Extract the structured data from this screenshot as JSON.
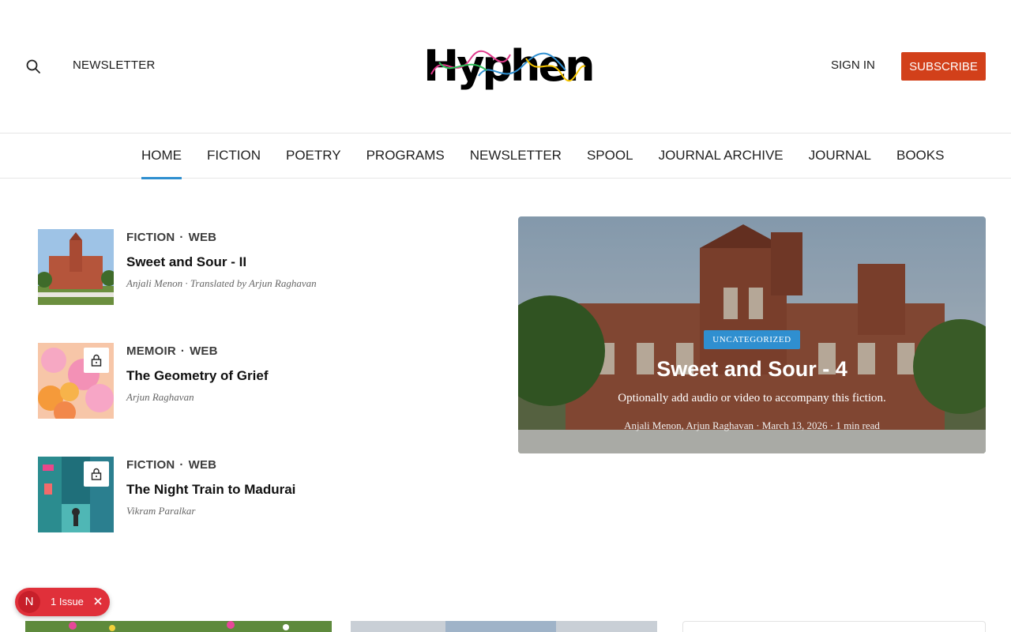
{
  "header": {
    "newsletter_label": "NEWSLETTER",
    "logo_text": "Hyphen",
    "signin_label": "SIGN IN",
    "subscribe_label": "SUBSCRIBE"
  },
  "nav": {
    "items": [
      "HOME",
      "FICTION",
      "POETRY",
      "PROGRAMS",
      "NEWSLETTER",
      "SPOOL",
      "JOURNAL ARCHIVE",
      "JOURNAL",
      "BOOKS"
    ],
    "active": "HOME"
  },
  "stories": [
    {
      "category": "FICTION",
      "format": "WEB",
      "title": "Sweet and Sour - II",
      "byline": "Anjali Menon · Translated by Arjun Raghavan",
      "locked": false
    },
    {
      "category": "MEMOIR",
      "format": "WEB",
      "title": "The Geometry of Grief",
      "byline": "Arjun Raghavan",
      "locked": true
    },
    {
      "category": "FICTION",
      "format": "WEB",
      "title": "The Night Train to Madurai",
      "byline": "Vikram Paralkar",
      "locked": true
    }
  ],
  "feature": {
    "badge": "UNCATEGORIZED",
    "title": "Sweet and Sour - 4",
    "description": "Optionally add audio or video to accompany this fiction.",
    "byline": "Anjali Menon, Arjun Raghavan · March 13, 2026 · 1 min read"
  },
  "issue_badge": {
    "letter": "N",
    "label": "1 Issue"
  },
  "colors": {
    "accent_blue": "#2f8fd0",
    "subscribe_red": "#d2401a",
    "issue_red": "#e0303a"
  }
}
